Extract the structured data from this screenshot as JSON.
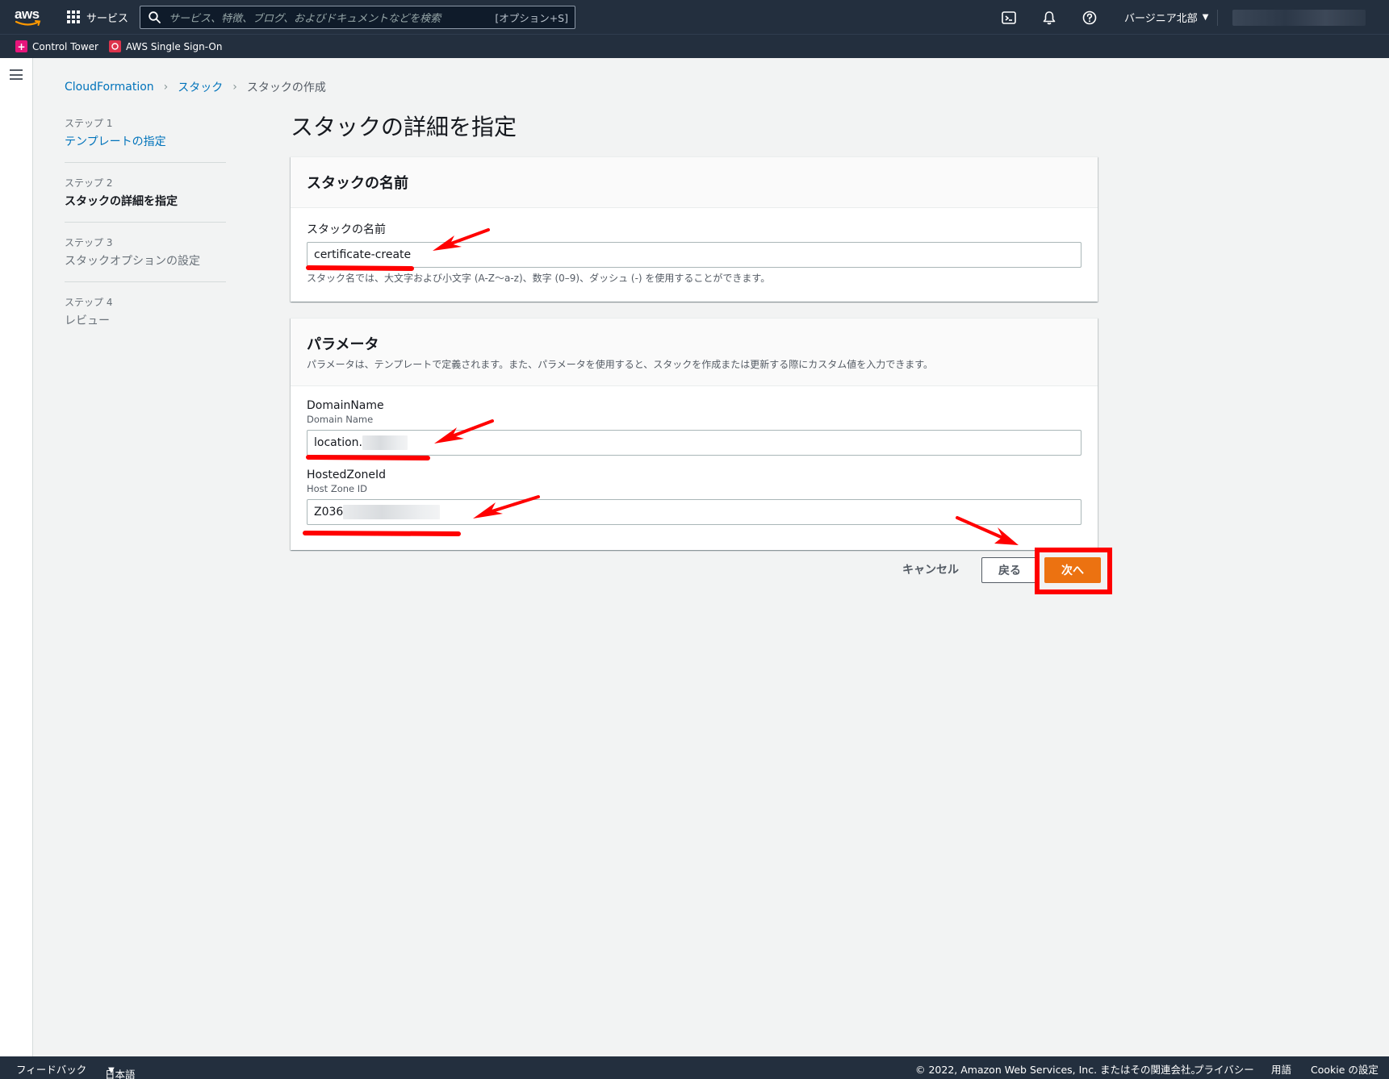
{
  "topnav": {
    "logo": "aws",
    "services": "サービス",
    "search_placeholder": "サービス、特徴、ブログ、およびドキュメントなどを検索",
    "search_shortcut": "[オプション+S]",
    "region": "バージニア北部"
  },
  "favorites": [
    {
      "label": "Control Tower"
    },
    {
      "label": "AWS Single Sign-On"
    }
  ],
  "breadcrumb": {
    "items": [
      "CloudFormation",
      "スタック",
      "スタックの作成"
    ]
  },
  "steps": [
    {
      "num": "ステップ 1",
      "label": "テンプレートの指定"
    },
    {
      "num": "ステップ 2",
      "label": "スタックの詳細を指定"
    },
    {
      "num": "ステップ 3",
      "label": "スタックオプションの設定"
    },
    {
      "num": "ステップ 4",
      "label": "レビュー"
    }
  ],
  "page_title": "スタックの詳細を指定",
  "stack_name_panel": {
    "title": "スタックの名前",
    "label": "スタックの名前",
    "value": "certificate-create",
    "hint": "スタック名では、大文字および小文字 (A-Z〜a-z)、数字 (0–9)、ダッシュ (-) を使用することができます。"
  },
  "params_panel": {
    "title": "パラメータ",
    "desc": "パラメータは、テンプレートで定義されます。また、パラメータを使用すると、スタックを作成または更新する際にカスタム値を入力できます。",
    "domain": {
      "label": "DomainName",
      "sub": "Domain Name",
      "value": "location."
    },
    "zone": {
      "label": "HostedZoneId",
      "sub": "Host Zone ID",
      "value": "Z036"
    }
  },
  "actions": {
    "cancel": "キャンセル",
    "back": "戻る",
    "next": "次へ"
  },
  "footer": {
    "feedback": "フィードバック",
    "language": "日本語",
    "copyright": "© 2022, Amazon Web Services, Inc. またはその関連会社。",
    "privacy": "プライバシー",
    "terms": "用語",
    "cookie": "Cookie の設定"
  },
  "colors": {
    "nav_bg": "#232f3e",
    "link": "#0073bb",
    "primary": "#ec7211",
    "annotation": "#ff0000"
  }
}
